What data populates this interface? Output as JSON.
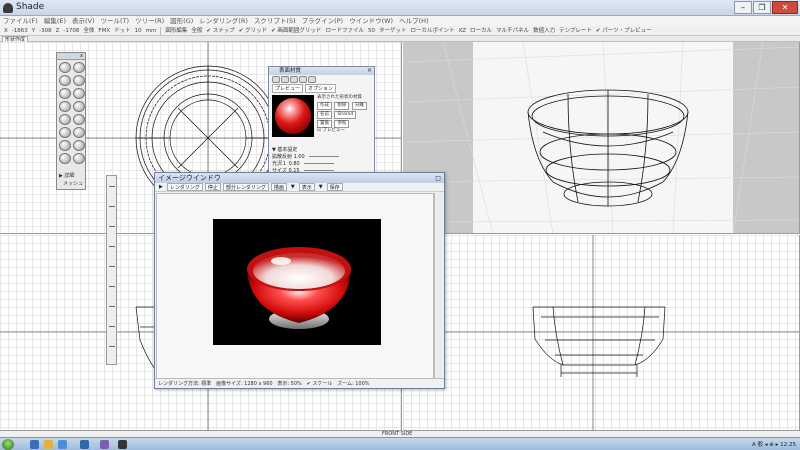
{
  "window": {
    "title": "Shade",
    "min_label": "–",
    "max_label": "❐",
    "close_label": "✕"
  },
  "menu": [
    "ファイル(F)",
    "編集(E)",
    "表示(V)",
    "ツール(T)",
    "ツリー(R)",
    "図形(G)",
    "レンダリング(R)",
    "スクリプト(S)",
    "プラグイン(P)",
    "ウインドウ(W)",
    "ヘルプ(H)"
  ],
  "toolbar": {
    "items": [
      "X",
      "-1863",
      "Y",
      "-308",
      "Z",
      "-1708",
      "全体",
      "FMX",
      "ドット",
      "10",
      "mm",
      "図形編集",
      "全般",
      "✔ スナップ",
      "✔ グリッド",
      "✔ 画面範囲グリッド",
      "ロードファイル",
      "50",
      "ターゲット",
      "ローカルポイント",
      "XZ",
      "ローカル",
      "マルチパネル",
      "数値入力",
      "テンプレート",
      "✔ パーツ・プレビュー"
    ]
  },
  "tab": {
    "label": "形状作成"
  },
  "tool_palette": {
    "title": "x",
    "footer": "▶ 詳細",
    "footer2": "メッシュ"
  },
  "material_window": {
    "title": "表面材質",
    "close": "×",
    "tabs": [
      "プレビュー",
      "オプション"
    ],
    "right_lines": [
      "表示された形状の材質",
      "作成",
      "削除",
      "分離",
      "名前",
      "Shared",
      "置換",
      "参照"
    ],
    "check_label": "☑ プレビュー",
    "section_title": "▼ 基本設定",
    "rows": [
      {
        "label": "拡散反射",
        "value": "1.00"
      },
      {
        "label": "光沢１",
        "value": "0.80"
      },
      {
        "label": "サイズ",
        "value": "0.15"
      }
    ]
  },
  "render_window": {
    "title": "イメージウインドウ",
    "min": "◻",
    "toolbar": [
      "▶",
      "レンダリング",
      "停止",
      "部分レンダリング",
      "描画",
      "▼",
      "表示",
      "▼",
      "保存"
    ],
    "status": "レンダリング方法: 標準",
    "status2": "画像サイズ: 1280 x 960",
    "status3": "表示: 50%",
    "status4": "✔ スケール",
    "status5": "ズーム: 100%"
  },
  "statusline": {
    "coord": "FRONT  SIDE"
  },
  "taskbar": {
    "tray_text": "A 般 ◂ ⊕ ▸ 12:25"
  },
  "colors": {
    "titlebar": "#cfdcec",
    "render_red": "#e01616",
    "wire": "#111111",
    "persp_bg": "#c8c8c8"
  }
}
